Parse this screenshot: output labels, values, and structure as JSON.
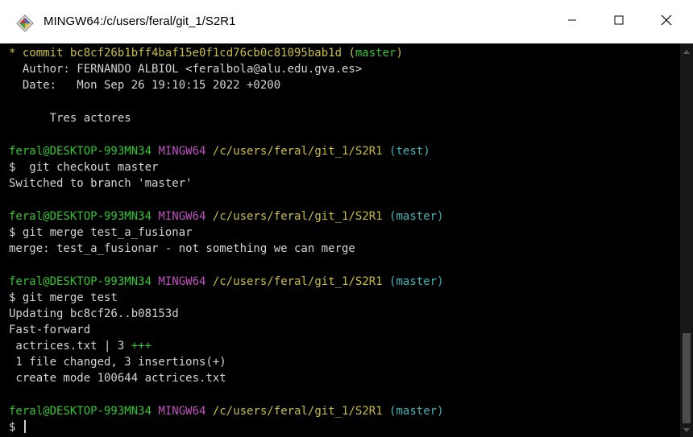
{
  "window": {
    "title": "MINGW64:/c/users/feral/git_1/S2R1",
    "icon": "git-bash-diamond-icon",
    "controls": {
      "minimize": "minimize-icon",
      "maximize": "maximize-icon",
      "close": "close-icon"
    }
  },
  "colors": {
    "background": "#000000",
    "text": "#d4d4d4",
    "commit_yellow": "#c8c03a",
    "user_green": "#2fc52f",
    "env_magenta": "#c050c0",
    "branch_cyan": "#3eb8b8"
  },
  "terminal": {
    "commit": {
      "marker": "* ",
      "label": "commit bc8cf26b1bff4baf15e0f1cd76cb0c81095bab1d (",
      "branch": "master",
      "close": ")",
      "author": "  Author: FERNANDO ALBIOL <feralbola@alu.edu.gva.es>",
      "date": "  Date:   Mon Sep 26 19:10:15 2022 +0200",
      "message": "      Tres actores"
    },
    "prompts": [
      {
        "user": "feral@DESKTOP-993MN34",
        "env": "MINGW64",
        "path": "/c/users/feral/git_1/S2R1",
        "branch": "(test)"
      },
      {
        "user": "feral@DESKTOP-993MN34",
        "env": "MINGW64",
        "path": "/c/users/feral/git_1/S2R1",
        "branch": "(master)"
      },
      {
        "user": "feral@DESKTOP-993MN34",
        "env": "MINGW64",
        "path": "/c/users/feral/git_1/S2R1",
        "branch": "(master)"
      },
      {
        "user": "feral@DESKTOP-993MN34",
        "env": "MINGW64",
        "path": "/c/users/feral/git_1/S2R1",
        "branch": "(master)"
      }
    ],
    "cmd1": "$  git checkout master",
    "out1": "Switched to branch 'master'",
    "cmd2": "$ git merge test_a_fusionar",
    "out2": "merge: test_a_fusionar - not something we can merge",
    "cmd3": "$ git merge test",
    "out3": [
      "Updating bc8cf26..b08153d",
      "Fast-forward"
    ],
    "stat_file": " actrices.txt | 3 ",
    "stat_plus": "+++",
    "out3b": [
      " 1 file changed, 3 insertions(+)",
      " create mode 100644 actrices.txt"
    ],
    "final_prompt_symbol": "$ "
  }
}
